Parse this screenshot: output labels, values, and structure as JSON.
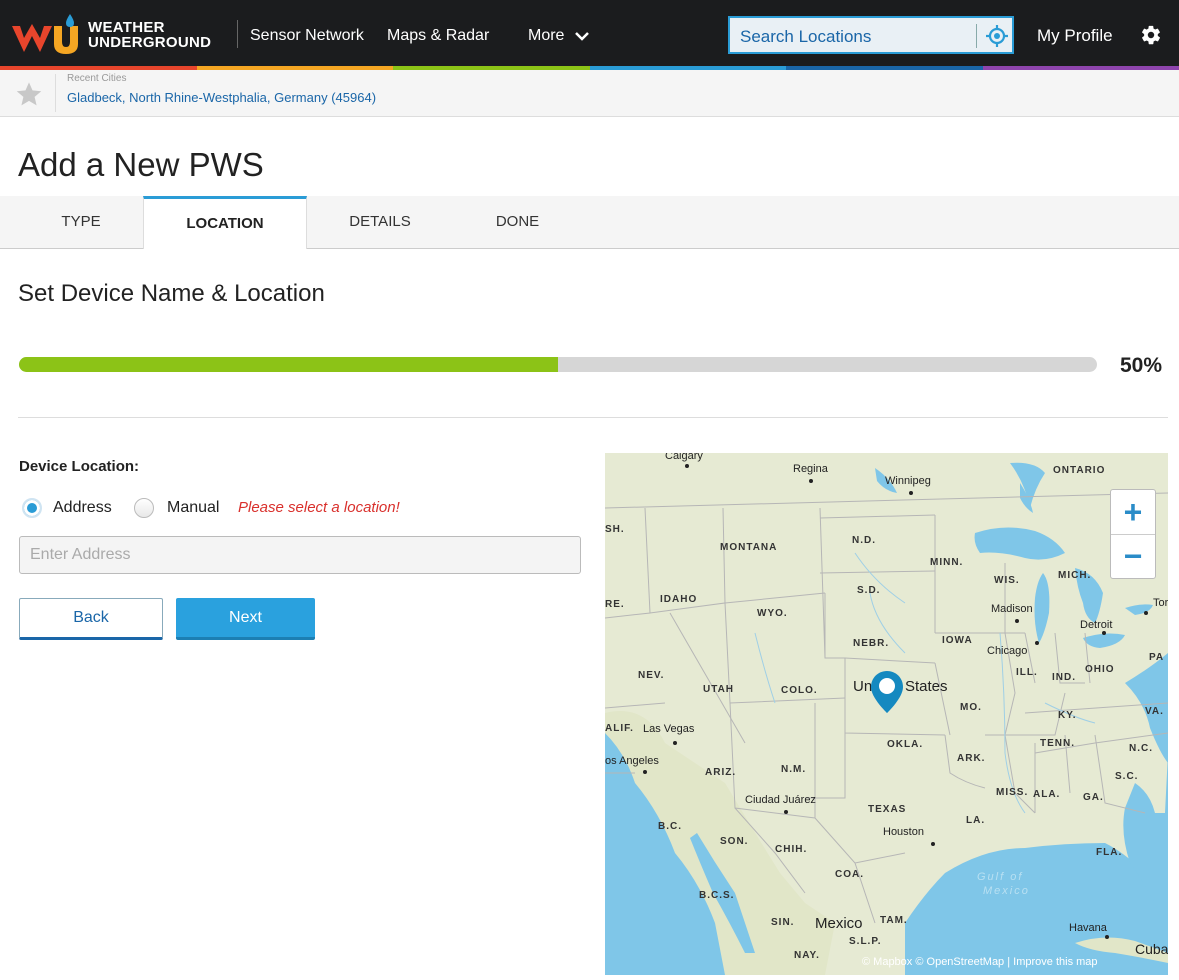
{
  "header": {
    "logo_line1": "WEATHER",
    "logo_line2": "UNDERGROUND",
    "nav": [
      "Sensor Network",
      "Maps & Radar",
      "More"
    ],
    "search_placeholder": "Search Locations",
    "profile_label": "My Profile"
  },
  "recent": {
    "label": "Recent Cities",
    "city": "Gladbeck, North Rhine-Westphalia, Germany (45964)"
  },
  "page": {
    "title": "Add a New PWS",
    "tabs": [
      "TYPE",
      "LOCATION",
      "DETAILS",
      "DONE"
    ],
    "active_tab": "LOCATION",
    "subtitle": "Set Device Name & Location",
    "progress_percent": 50,
    "progress_label": "50%"
  },
  "form": {
    "device_location_label": "Device Location:",
    "radio_address": "Address",
    "radio_manual": "Manual",
    "selected": "Address",
    "warning": "Please select a location!",
    "address_placeholder": "Enter Address",
    "address_value": "",
    "back_label": "Back",
    "next_label": "Next"
  },
  "map": {
    "state_labels": [
      "ONTARIO",
      "N.D.",
      "MONTANA",
      "MINN.",
      "WIS.",
      "MICH.",
      "S.D.",
      "IDAHO",
      "WYO.",
      "NEBR.",
      "IOWA",
      "NEV.",
      "UTAH",
      "COLO.",
      "ILL.",
      "IND.",
      "OHIO",
      "MO.",
      "KY.",
      "VA.",
      "OKLA.",
      "TENN.",
      "N.C.",
      "ARK.",
      "ARIZ.",
      "N.M.",
      "S.C.",
      "MISS.",
      "ALA.",
      "GA.",
      "TEXAS",
      "LA.",
      "SON.",
      "CHIH.",
      "FLA.",
      "COA.",
      "B.C.S.",
      "SIN.",
      "TAM.",
      "S.L.P.",
      "NAY.",
      "B.C.",
      "ALIF.",
      "SH.",
      "RE.",
      "PA"
    ],
    "cities": [
      "Calgary",
      "Regina",
      "Winnipeg",
      "Madison",
      "Detroit",
      "Tor",
      "Chicago",
      "Las Vegas",
      "os Angeles",
      "Ciudad Juárez",
      "Houston",
      "Havana",
      "Cuba",
      "Mexico",
      "Un",
      "States",
      "Gulf of",
      "Mexico"
    ],
    "zoom_in": "+",
    "zoom_out": "−",
    "attribution": [
      "© Mapbox",
      "© OpenStreetMap",
      "Improve this map"
    ]
  },
  "colors": {
    "accent": "#2a9cd6",
    "progress": "#8cc317",
    "warning": "#d9302c",
    "link": "#1a66a8"
  }
}
